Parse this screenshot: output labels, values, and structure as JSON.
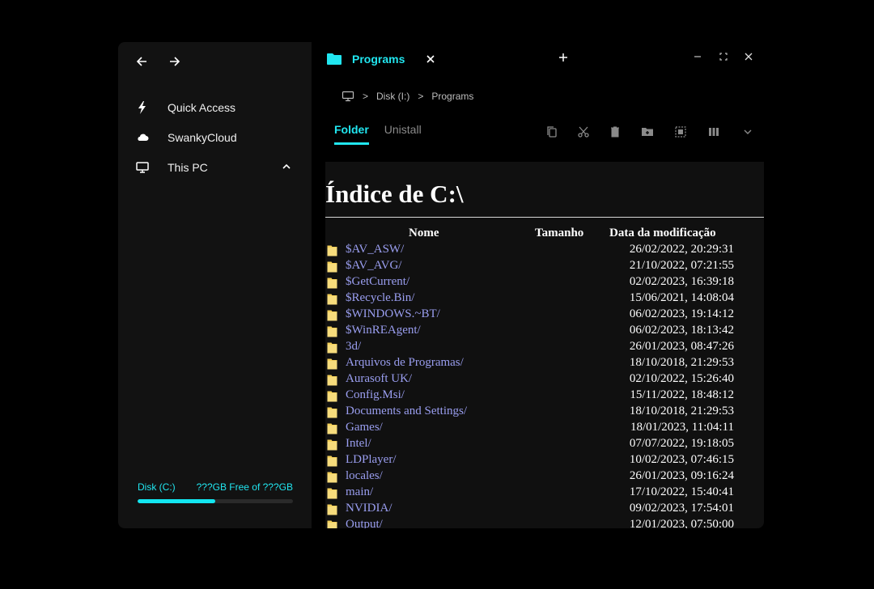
{
  "sidebar": {
    "items": [
      {
        "label": "Quick Access",
        "icon": "lightning-icon"
      },
      {
        "label": "SwankyCloud",
        "icon": "cloud-icon"
      },
      {
        "label": "This PC",
        "icon": "monitor-icon"
      }
    ],
    "disk": {
      "label": "Disk (C:)",
      "free_text": "???GB Free of ???GB",
      "usage": 0.5
    }
  },
  "tab": {
    "title": "Programs"
  },
  "breadcrumb": {
    "items": [
      "Disk (I:)",
      "Programs"
    ]
  },
  "ribbon": {
    "tabs": [
      "Folder",
      "Unistall"
    ]
  },
  "listing": {
    "title": "Índice de C:\\",
    "columns": {
      "name": "Nome",
      "size": "Tamanho",
      "modified": "Data da modificação"
    },
    "rows": [
      {
        "name": "$AV_ASW/",
        "modified": "26/02/2022, 20:29:31"
      },
      {
        "name": "$AV_AVG/",
        "modified": "21/10/2022, 07:21:55"
      },
      {
        "name": "$GetCurrent/",
        "modified": "02/02/2023, 16:39:18"
      },
      {
        "name": "$Recycle.Bin/",
        "modified": "15/06/2021, 14:08:04"
      },
      {
        "name": "$WINDOWS.~BT/",
        "modified": "06/02/2023, 19:14:12"
      },
      {
        "name": "$WinREAgent/",
        "modified": "06/02/2023, 18:13:42"
      },
      {
        "name": "3d/",
        "modified": "26/01/2023, 08:47:26"
      },
      {
        "name": "Arquivos de Programas/",
        "modified": "18/10/2018, 21:29:53"
      },
      {
        "name": "Aurasoft UK/",
        "modified": "02/10/2022, 15:26:40"
      },
      {
        "name": "Config.Msi/",
        "modified": "15/11/2022, 18:48:12"
      },
      {
        "name": "Documents and Settings/",
        "modified": "18/10/2018, 21:29:53"
      },
      {
        "name": "Games/",
        "modified": "18/01/2023, 11:04:11"
      },
      {
        "name": "Intel/",
        "modified": "07/07/2022, 19:18:05"
      },
      {
        "name": "LDPlayer/",
        "modified": "10/02/2023, 07:46:15"
      },
      {
        "name": "locales/",
        "modified": "26/01/2023, 09:16:24"
      },
      {
        "name": "main/",
        "modified": "17/10/2022, 15:40:41"
      },
      {
        "name": "NVIDIA/",
        "modified": "09/02/2023, 17:54:01"
      },
      {
        "name": "Output/",
        "modified": "12/01/2023, 07:50:00"
      }
    ]
  },
  "colors": {
    "accent": "#21e6f0",
    "link": "#9a9ef0",
    "folder": "#f3cf58"
  }
}
